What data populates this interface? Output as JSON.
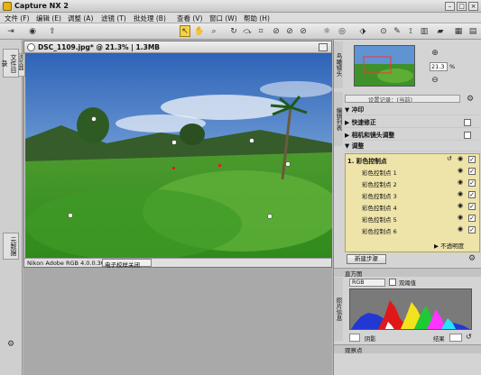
{
  "app": {
    "title": "Capture NX 2"
  },
  "menus": [
    "文件 (F)",
    "编辑 (E)",
    "调整 (A)",
    "滤镜 (T)",
    "批处理 (B)",
    "查看 (V)",
    "窗口 (W)",
    "帮助 (H)"
  ],
  "left_tabs": {
    "browser": "文件目录",
    "metadata": "元数据"
  },
  "image_window": {
    "title": "DSC_1109.jpg* @ 21.3% | 1.3MB",
    "browser_tab": "浏览器",
    "color_profile": "Nikon Adobe RGB 4.0.0.3000",
    "dropdown": "电子校样关闭"
  },
  "birds_eye": {
    "label": "鸟瞰镜头",
    "zoom": "21.3",
    "zoom_unit": "%"
  },
  "edit_list": {
    "label": "编辑列表",
    "preset": "设置记录：(当前)",
    "sections": {
      "develop": "冲印",
      "quick_fix": "快速修正",
      "camera_lens": "相机和镜头调整",
      "adjust": "调整"
    },
    "step_title": "1. 彩色控制点",
    "items": [
      "彩色控制点 1",
      "彩色控制点 2",
      "彩色控制点 3",
      "彩色控制点 4",
      "彩色控制点 5",
      "彩色控制点 6"
    ],
    "opacity_label": "不透明度",
    "new_step": "新建步骤"
  },
  "histogram": {
    "label": "直方图",
    "side": "照片信息",
    "channel": "RGB",
    "dual": "双阈值",
    "shadow_label": "阴影",
    "highlight_label": "结果"
  },
  "watch_points": {
    "label": "观察点"
  },
  "colors": {
    "accent": "#f6d24a",
    "selection": "#eee3a8"
  }
}
